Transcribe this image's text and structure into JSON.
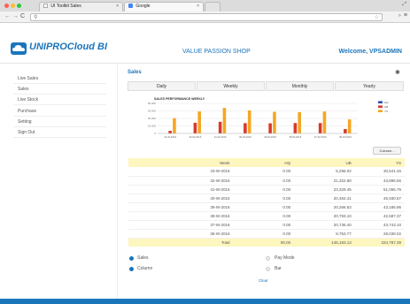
{
  "browser": {
    "tabs": [
      {
        "label": "UI Toolkit Sales"
      },
      {
        "label": "Google"
      }
    ]
  },
  "app": {
    "logo_text": "UNIPROCloud BI",
    "shop_name": "VALUE PASSION SHOP",
    "welcome": "Welcome, VPSADMIN"
  },
  "sidebar": {
    "items": [
      {
        "label": "Live Sales"
      },
      {
        "label": "Sales"
      },
      {
        "label": "Live Stock"
      },
      {
        "label": "Purchase"
      },
      {
        "label": "Setting"
      },
      {
        "label": "Sign Out"
      }
    ]
  },
  "main": {
    "title": "Sales",
    "tabs": [
      {
        "label": "Daily"
      },
      {
        "label": "Weekly"
      },
      {
        "label": "Monthly"
      },
      {
        "label": "Yearly"
      }
    ],
    "columns_button": "Column...",
    "clear_label": "Clear"
  },
  "chart_data": {
    "type": "bar",
    "title": "SALES PERFORMANCE WEEKLY",
    "categories": [
      "31-W-2016",
      "32-W-2016",
      "41-W-2016",
      "40-W-2016",
      "39-W-2016",
      "38-W-2016",
      "37-W-2016",
      "36-W-2016"
    ],
    "series": [
      {
        "name": "HQ",
        "color": "#2a4fa8",
        "values": [
          0,
          0,
          0,
          0,
          0,
          0,
          0,
          0
        ]
      },
      {
        "name": "UB",
        "color": "#d93a2b",
        "values": [
          5296,
          21323,
          23329,
          20484,
          20266,
          20793,
          20736,
          8753
        ]
      },
      {
        "name": "YS",
        "color": "#f5a623",
        "values": [
          30541,
          43896,
          51066,
          45930,
          43186,
          42587,
          43743,
          28038
        ]
      }
    ],
    "yticks": [
      "60,000",
      "45,000",
      "30,000",
      "15,000",
      "0"
    ],
    "ylim": [
      0,
      60000
    ]
  },
  "table": {
    "headers": [
      "Week",
      "HQ",
      "UB",
      "YS"
    ],
    "rows": [
      [
        "43-W-2016",
        "0.00",
        "5,296.02",
        "30,541.46"
      ],
      [
        "42-W-2016",
        "0.00",
        "21,322.88",
        "43,896.56"
      ],
      [
        "41-W-2016",
        "0.00",
        "23,329.45",
        "51,065.75"
      ],
      [
        "40-W-2016",
        "0.00",
        "20,484.41",
        "45,930.87"
      ],
      [
        "39-W-2016",
        "0.00",
        "20,266.63",
        "43,185.96"
      ],
      [
        "38-W-2016",
        "0.00",
        "20,793.10",
        "42,587.37"
      ],
      [
        "37-W-2016",
        "0.00",
        "20,736.40",
        "43,743.10"
      ],
      [
        "36-W-2016",
        "0.00",
        "8,753.77",
        "28,038.02"
      ]
    ],
    "total_label": "Total",
    "total_values": [
      "00.00",
      "145,183.13",
      "334,787.39"
    ]
  },
  "options": {
    "left": [
      {
        "label": "Sales",
        "selected": true
      },
      {
        "label": "Column",
        "selected": true
      }
    ],
    "right": [
      {
        "label": "Pay Mode",
        "selected": false
      },
      {
        "label": "Bar",
        "selected": false
      }
    ]
  }
}
